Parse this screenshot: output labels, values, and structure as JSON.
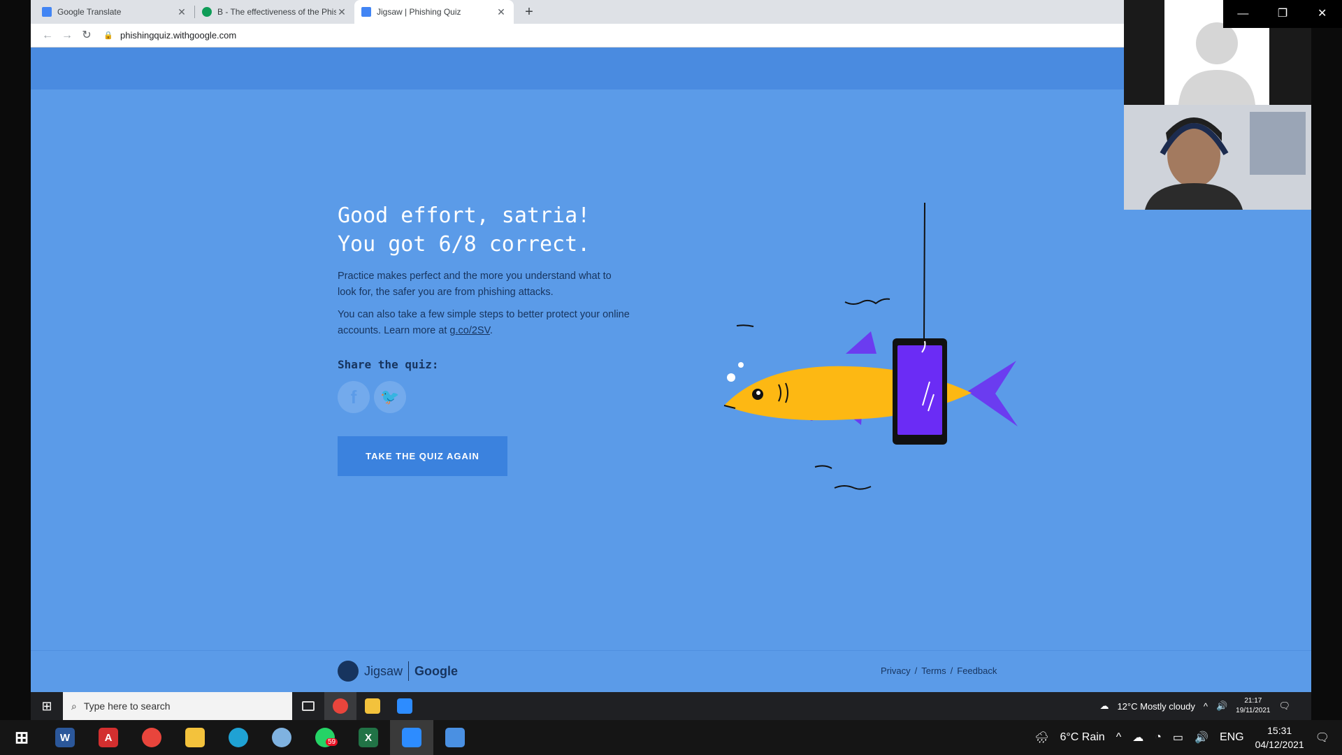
{
  "browser": {
    "tabs": [
      {
        "title": "Google Translate",
        "favicon_color": "#4285f4"
      },
      {
        "title": "B - The effectiveness of the Phis",
        "favicon_color": "#0f9d58"
      },
      {
        "title": "Jigsaw | Phishing Quiz",
        "favicon_color": "#4285f4"
      }
    ],
    "url": "phishingquiz.withgoogle.com"
  },
  "quiz": {
    "headline": "Good effort, satria!\nYou got 6/8 correct.",
    "para1": "Practice makes perfect and the more you understand what to look for, the safer you are from phishing attacks.",
    "para2_prefix": "You can also take a few simple steps to better protect your online accounts. Learn more at ",
    "para2_link": "g.co/2SV",
    "para2_suffix": ".",
    "share_label": "Share the quiz:",
    "retake_label": "TAKE THE QUIZ AGAIN"
  },
  "footer": {
    "brand_left": "Jigsaw",
    "brand_right": "Google",
    "links": [
      "Privacy",
      "Terms",
      "Feedback"
    ],
    "separator": "/"
  },
  "taskbar_inner": {
    "search_placeholder": "Type here to search",
    "weather": "12°C  Mostly cloudy",
    "time": "21:17",
    "date": "19/11/2021"
  },
  "taskbar_host": {
    "weather": "6°C  Rain",
    "lang": "ENG",
    "time": "15:31",
    "date": "04/12/2021",
    "whatsapp_badge": "59"
  },
  "colors": {
    "page_bg": "#5b9be8",
    "accent": "#3b82de",
    "text_dark": "#17345e"
  }
}
